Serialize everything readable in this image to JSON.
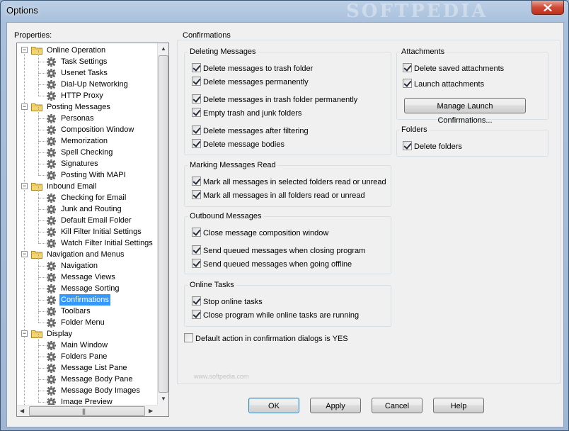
{
  "window": {
    "title": "Options",
    "watermark": "SOFTPEDIA"
  },
  "sidebar": {
    "label": "Properties:",
    "tree": [
      {
        "label": "Online Operation",
        "level": 0,
        "type": "folder"
      },
      {
        "label": "Task Settings",
        "level": 1,
        "type": "item"
      },
      {
        "label": "Usenet Tasks",
        "level": 1,
        "type": "item"
      },
      {
        "label": "Dial-Up Networking",
        "level": 1,
        "type": "item"
      },
      {
        "label": "HTTP Proxy",
        "level": 1,
        "type": "item"
      },
      {
        "label": "Posting Messages",
        "level": 0,
        "type": "folder"
      },
      {
        "label": "Personas",
        "level": 1,
        "type": "item"
      },
      {
        "label": "Composition Window",
        "level": 1,
        "type": "item"
      },
      {
        "label": "Memorization",
        "level": 1,
        "type": "item"
      },
      {
        "label": "Spell Checking",
        "level": 1,
        "type": "item"
      },
      {
        "label": "Signatures",
        "level": 1,
        "type": "item"
      },
      {
        "label": "Posting With MAPI",
        "level": 1,
        "type": "item"
      },
      {
        "label": "Inbound Email",
        "level": 0,
        "type": "folder"
      },
      {
        "label": "Checking for Email",
        "level": 1,
        "type": "item"
      },
      {
        "label": "Junk and Routing",
        "level": 1,
        "type": "item"
      },
      {
        "label": "Default Email Folder",
        "level": 1,
        "type": "item"
      },
      {
        "label": "Kill Filter Initial Settings",
        "level": 1,
        "type": "item"
      },
      {
        "label": "Watch Filter Initial Settings",
        "level": 1,
        "type": "item"
      },
      {
        "label": "Navigation and Menus",
        "level": 0,
        "type": "folder"
      },
      {
        "label": "Navigation",
        "level": 1,
        "type": "item"
      },
      {
        "label": "Message Views",
        "level": 1,
        "type": "item"
      },
      {
        "label": "Message Sorting",
        "level": 1,
        "type": "item"
      },
      {
        "label": "Confirmations",
        "level": 1,
        "type": "item",
        "selected": true
      },
      {
        "label": "Toolbars",
        "level": 1,
        "type": "item"
      },
      {
        "label": "Folder Menu",
        "level": 1,
        "type": "item"
      },
      {
        "label": "Display",
        "level": 0,
        "type": "folder"
      },
      {
        "label": "Main Window",
        "level": 1,
        "type": "item"
      },
      {
        "label": "Folders Pane",
        "level": 1,
        "type": "item"
      },
      {
        "label": "Message List Pane",
        "level": 1,
        "type": "item"
      },
      {
        "label": "Message Body Pane",
        "level": 1,
        "type": "item"
      },
      {
        "label": "Message Body Images",
        "level": 1,
        "type": "item"
      },
      {
        "label": "Image Preview",
        "level": 1,
        "type": "item"
      }
    ]
  },
  "panel": {
    "title": "Confirmations",
    "groups": {
      "deleting": {
        "title": "Deleting Messages",
        "items": [
          {
            "label": "Delete messages to trash folder",
            "checked": true
          },
          {
            "label": "Delete messages permanently",
            "checked": true
          },
          {
            "label": "Delete messages in trash folder permanently",
            "checked": true
          },
          {
            "label": "Empty trash and junk folders",
            "checked": true
          },
          {
            "label": "Delete messages after filtering",
            "checked": true
          },
          {
            "label": "Delete message bodies",
            "checked": true
          }
        ]
      },
      "marking": {
        "title": "Marking Messages Read",
        "items": [
          {
            "label": "Mark all messages in selected folders read or unread",
            "checked": true
          },
          {
            "label": "Mark all messages in all folders read or unread",
            "checked": true
          }
        ]
      },
      "outbound": {
        "title": "Outbound Messages",
        "items": [
          {
            "label": "Close message composition window",
            "checked": true
          },
          {
            "label": "Send queued messages when closing program",
            "checked": true
          },
          {
            "label": "Send queued messages when going offline",
            "checked": true
          }
        ]
      },
      "online": {
        "title": "Online Tasks",
        "items": [
          {
            "label": "Stop online tasks",
            "checked": true
          },
          {
            "label": "Close program while online tasks are running",
            "checked": true
          }
        ]
      },
      "attachments": {
        "title": "Attachments",
        "items": [
          {
            "label": "Delete saved attachments",
            "checked": true
          },
          {
            "label": "Launch attachments",
            "checked": true
          }
        ],
        "button": "Manage Launch Confirmations..."
      },
      "folders": {
        "title": "Folders",
        "items": [
          {
            "label": "Delete folders",
            "checked": true
          }
        ]
      }
    },
    "default_yes": {
      "label": "Default action in confirmation dialogs is YES",
      "checked": false
    },
    "watermark_url": "www.softpedia.com"
  },
  "buttons": {
    "ok": "OK",
    "apply": "Apply",
    "cancel": "Cancel",
    "help": "Help"
  },
  "colors": {
    "selection": "#3399ff",
    "window_frame": "#a9c0dc",
    "close_button": "#c9412c"
  }
}
